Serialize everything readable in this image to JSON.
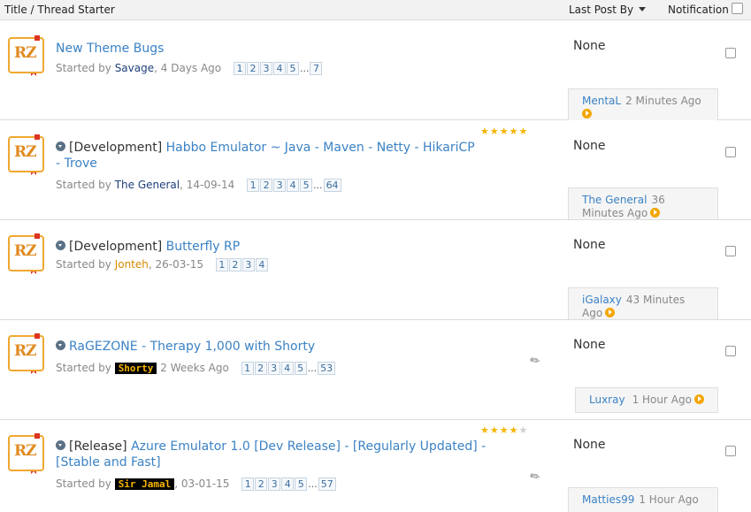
{
  "header": {
    "title_col": "Title / Thread Starter",
    "lastpost_col": "Last Post By",
    "notif_col": "Notification"
  },
  "threads": [
    {
      "prefix": "",
      "title": "New Theme Bugs",
      "started_by_label": "Started by",
      "author": "Savage",
      "date": ", 4 Days Ago",
      "pages": [
        "1",
        "2",
        "3",
        "4",
        "5",
        "...",
        "7"
      ],
      "rating": null,
      "none_label": "None",
      "last_user": "MentaL",
      "last_time": "2 Minutes Ago"
    },
    {
      "prefix": "[Development]",
      "title": "Habbo Emulator ~ Java - Maven - Netty - HikariCP - Trove",
      "started_by_label": "Started by",
      "author": "The General",
      "date": ", 14-09-14",
      "pages": [
        "1",
        "2",
        "3",
        "4",
        "5",
        "...",
        "64"
      ],
      "rating": 5,
      "none_label": "None",
      "last_user": "The General",
      "last_time": "36 Minutes Ago"
    },
    {
      "prefix": "[Development]",
      "title": "Butterfly RP",
      "started_by_label": "Started by",
      "author": "Jonteh",
      "date": ", 26-03-15",
      "pages": [
        "1",
        "2",
        "3",
        "4"
      ],
      "rating": null,
      "none_label": "None",
      "last_user": "iGalaxy",
      "last_time": "43 Minutes Ago"
    },
    {
      "prefix": "",
      "title": "RaGEZONE - Therapy 1,000 with Shorty",
      "started_by_label": "Started by",
      "author": "Shorty",
      "date": " 2 Weeks Ago",
      "pages": [
        "1",
        "2",
        "3",
        "4",
        "5",
        "...",
        "53"
      ],
      "rating": null,
      "none_label": "None",
      "last_user": "Luxray",
      "last_time": "1 Hour Ago"
    },
    {
      "prefix": "[Release]",
      "title": "Azure Emulator 1.0 [Dev Release] - [Regularly Updated] - [Stable and Fast]",
      "started_by_label": "Started by",
      "author": "Sir Jamal",
      "date": ", 03-01-15",
      "pages": [
        "1",
        "2",
        "3",
        "4",
        "5",
        "...",
        "57"
      ],
      "rating": 4,
      "none_label": "None",
      "last_user": "Matties99",
      "last_time": "1 Hour Ago"
    }
  ],
  "colors": {
    "link": "#3b82c4",
    "avatar_border": "#f0a830",
    "star": "#f5b400",
    "go_icon": "#f3a600"
  }
}
